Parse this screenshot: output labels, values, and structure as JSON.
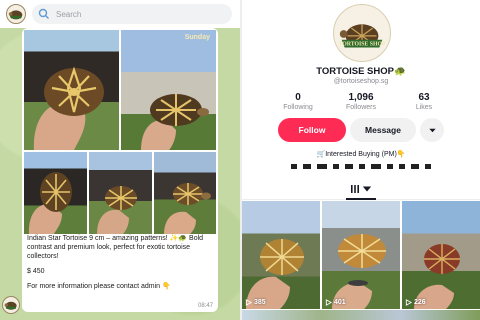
{
  "chat": {
    "search": {
      "placeholder": "Search"
    },
    "photo_overlay": "Sunday",
    "caption": {
      "line1": "Indian Star Tortoise 9 cm – amazing patterns! ✨🐢 Bold contrast and premium look, perfect for exotic tortoise collectors!",
      "price": "$ 450",
      "contact": "For more information please contact admin 👇"
    },
    "time": "08:47"
  },
  "profile": {
    "logo_text": "TORTOISE SHOP",
    "name": "TORTOISE SHOP🐢",
    "handle": "@tortoiseshop.sg",
    "stats": [
      {
        "value": "0",
        "label": "Following"
      },
      {
        "value": "1,096",
        "label": "Followers"
      },
      {
        "value": "63",
        "label": "Likes"
      }
    ],
    "follow_label": "Follow",
    "message_label": "Message",
    "bio": "🛒Interested Buying (PM)👇",
    "videos": [
      {
        "views": "385"
      },
      {
        "views": "401"
      },
      {
        "views": "226"
      }
    ]
  },
  "colors": {
    "follow": "#fe2c55",
    "chat_bg": "#c4d9a3"
  },
  "icons": {
    "search": "search-icon",
    "play": "play-icon",
    "grid": "grid-icon",
    "dropdown": "chevron-down-icon"
  }
}
